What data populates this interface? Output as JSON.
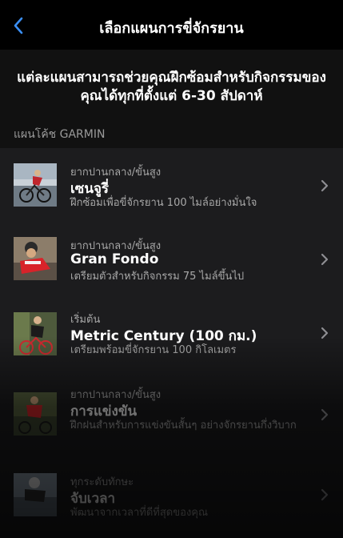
{
  "nav": {
    "title": "เลือกแผนการขี่จักรยาน",
    "back_icon": "chevron-left-icon",
    "accent": "#3b8ff5"
  },
  "intro": {
    "text": "แต่ละแผนสามารถช่วยคุณฝึกซ้อมสำหรับกิจกรรมของคุณได้ทุกที่ตั้งแต่ 6-30 สัปดาห์"
  },
  "section": {
    "header": "แผนโค้ช GARMIN"
  },
  "plans": [
    {
      "level": "ยากปานกลาง/ขั้นสูง",
      "name": "เซนจูรี่",
      "description": "ฝึกซ้อมเพื่อขี่จักรยาน 100 ไมล์อย่างมั่นใจ"
    },
    {
      "level": "ยากปานกลาง/ขั้นสูง",
      "name": "Gran Fondo",
      "description": "เตรียมตัวสำหรับกิจกรรม 75 ไมล์ขึ้นไป"
    },
    {
      "level": "เริ่มต้น",
      "name": "Metric Century (100 กม.)",
      "description": "เตรียมพร้อมขี่จักรยาน 100 กิโลเมตร"
    },
    {
      "level": "ยากปานกลาง/ขั้นสูง",
      "name": "การแข่งขัน",
      "description": "ฝึกฝนสำหรับการแข่งขันสั้นๆ อย่างจักรยานกึ่งวิบาก"
    },
    {
      "level": "ทุกระดับทักษะ",
      "name": "จับเวลา",
      "description": "พัฒนาจากเวลาที่ดีที่สุดของคุณ"
    }
  ]
}
